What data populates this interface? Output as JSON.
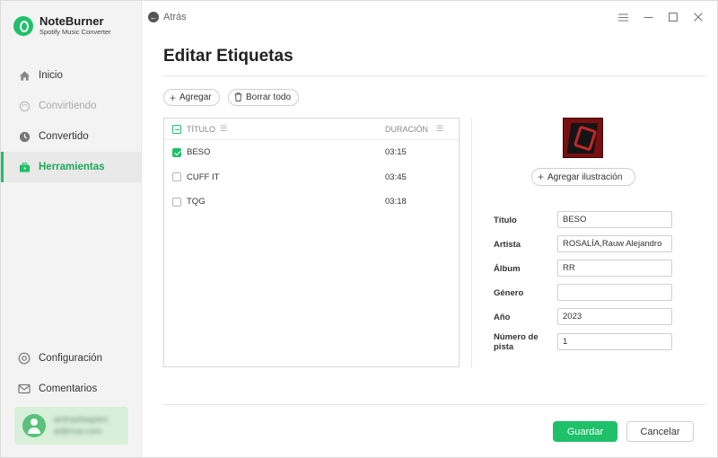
{
  "app": {
    "name": "NoteBurner",
    "subtitle": "Spotify Music Converter",
    "accent_color": "#1fc06a"
  },
  "sidebar": {
    "items": [
      {
        "label": "Inicio",
        "icon": "home-icon",
        "state": "normal"
      },
      {
        "label": "Convirtiendo",
        "icon": "sync-icon",
        "state": "disabled"
      },
      {
        "label": "Convertido",
        "icon": "clock-icon",
        "state": "normal"
      },
      {
        "label": "Herramientas",
        "icon": "toolbox-icon",
        "state": "active"
      }
    ],
    "bottom_items": [
      {
        "label": "Configuración",
        "icon": "gear-icon"
      },
      {
        "label": "Comentarios",
        "icon": "mail-icon"
      }
    ],
    "user": {
      "line1": "anthaafaaplen",
      "line2": "al@mar.com"
    }
  },
  "topbar": {
    "back_label": "Atrás"
  },
  "page": {
    "title": "Editar Etiquetas"
  },
  "toolbar": {
    "add_label": "Agregar",
    "clear_label": "Borrar todo"
  },
  "tracks": {
    "headers": {
      "title": "TÍTULO",
      "duration": "DURACIÓN"
    },
    "rows": [
      {
        "title": "BESO",
        "duration": "03:15",
        "checked": true
      },
      {
        "title": "CUFF IT",
        "duration": "03:45",
        "checked": false
      },
      {
        "title": "TQG",
        "duration": "03:18",
        "checked": false
      }
    ]
  },
  "artwork": {
    "add_label": "Agregar ilustración"
  },
  "form": {
    "title": {
      "label": "Título",
      "value": "BESO"
    },
    "artist": {
      "label": "Artista",
      "value": "ROSALÍA,Rauw Alejandro"
    },
    "album": {
      "label": "Álbum",
      "value": "RR"
    },
    "genre": {
      "label": "Género",
      "value": ""
    },
    "year": {
      "label": "Año",
      "value": "2023"
    },
    "track_number": {
      "label": "Número de pista",
      "value": "1"
    }
  },
  "footer": {
    "save_label": "Guardar",
    "cancel_label": "Cancelar"
  }
}
